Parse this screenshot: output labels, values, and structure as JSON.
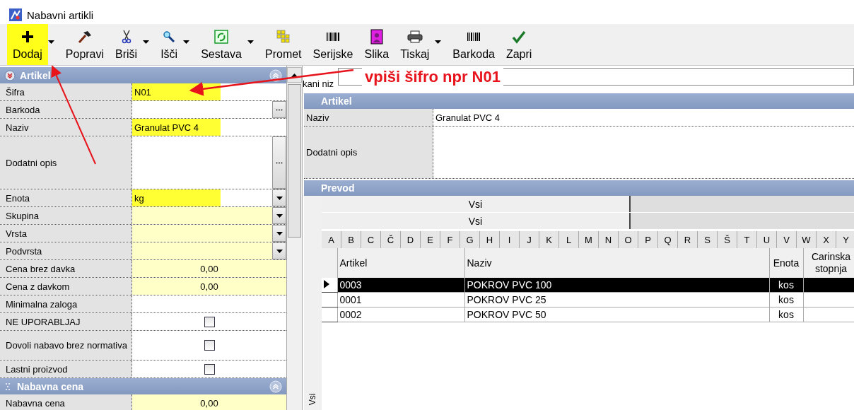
{
  "window": {
    "title": "Nabavni artikli"
  },
  "toolbar": [
    {
      "label": "Dodaj",
      "dropdown": true,
      "highlighted": true
    },
    {
      "label": "Popravi",
      "dropdown": false,
      "highlighted": false
    },
    {
      "label": "Briši",
      "dropdown": true,
      "highlighted": false
    },
    {
      "label": "Išči",
      "dropdown": true,
      "highlighted": false
    },
    {
      "label": "Sestava",
      "dropdown": true,
      "highlighted": false
    },
    {
      "label": "Promet",
      "dropdown": false,
      "highlighted": false
    },
    {
      "label": "Serijske",
      "dropdown": false,
      "highlighted": false
    },
    {
      "label": "Slika",
      "dropdown": false,
      "highlighted": false
    },
    {
      "label": "Tiskaj",
      "dropdown": true,
      "highlighted": false
    },
    {
      "label": "Barkoda",
      "dropdown": false,
      "highlighted": false
    },
    {
      "label": "Zapri",
      "dropdown": false,
      "highlighted": false
    }
  ],
  "properties": {
    "sections": [
      {
        "title": "Artikel",
        "rows": [
          {
            "label": "Šifra",
            "kind": "text",
            "value": "N01",
            "required": false,
            "highlighted": true
          },
          {
            "label": "Barkoda",
            "kind": "ellipsis",
            "required": false,
            "highlighted": false
          },
          {
            "label": "Naziv",
            "kind": "text",
            "value": "Granulat PVC 4",
            "required": false,
            "highlighted": true
          },
          {
            "label": "Dodatni opis",
            "kind": "memo",
            "required": false,
            "highlighted": false
          },
          {
            "label": "Enota",
            "kind": "dropdown",
            "value": "kg",
            "required": false,
            "highlighted": true
          },
          {
            "label": "Skupina",
            "kind": "dropdown",
            "required": true,
            "highlighted": false
          },
          {
            "label": "Vrsta",
            "kind": "dropdown",
            "required": true,
            "highlighted": false
          },
          {
            "label": "Podvrsta",
            "kind": "dropdown",
            "required": true,
            "highlighted": false
          },
          {
            "label": "Cena brez davka",
            "kind": "number",
            "value": "0,00",
            "required": true,
            "highlighted": false
          },
          {
            "label": "Cena z davkom",
            "kind": "number",
            "value": "0,00",
            "required": true,
            "highlighted": false
          },
          {
            "label": "Minimalna zaloga",
            "kind": "number",
            "required": false,
            "highlighted": false
          },
          {
            "label": "NE UPORABLJAJ",
            "kind": "checkbox",
            "checked": false,
            "required": false,
            "highlighted": false
          },
          {
            "label": "Dovoli nabavo brez normativa",
            "kind": "checkbox",
            "checked": false,
            "required": false,
            "highlighted": false
          },
          {
            "label": "Lastni proizvod",
            "kind": "checkbox",
            "checked": false,
            "required": false,
            "highlighted": false
          }
        ]
      },
      {
        "title": "Nabavna cena",
        "rows": [
          {
            "label": "Nabavna cena",
            "kind": "number",
            "value": "0,00",
            "required": true,
            "highlighted": false
          }
        ]
      }
    ]
  },
  "search": {
    "label": "kani niz"
  },
  "annotation": {
    "text": "vpiši šifro npr N01"
  },
  "detail": {
    "title": "Artikel",
    "rows": [
      {
        "label": "Naziv",
        "kind": "text",
        "value": "Granulat PVC 4"
      },
      {
        "label": "Dodatni opis",
        "kind": "memo"
      }
    ]
  },
  "translation": {
    "title": "Prevod",
    "filters": [
      "Vsi",
      "Vsi"
    ],
    "letters": [
      "A",
      "B",
      "C",
      "Č",
      "D",
      "E",
      "F",
      "G",
      "H",
      "I",
      "J",
      "K",
      "L",
      "M",
      "N",
      "O",
      "P",
      "Q",
      "R",
      "S",
      "Š",
      "T",
      "U",
      "V",
      "W",
      "X",
      "Y"
    ],
    "side_label": "Vsi",
    "table": {
      "columns": [
        "Artikel",
        "Naziv",
        "Enota",
        "Carinska stopnja"
      ],
      "rows": [
        {
          "cells": [
            "0003",
            "POKROV PVC 100",
            "kos"
          ],
          "selected": true
        },
        {
          "cells": [
            "0001",
            "POKROV PVC 25",
            "kos"
          ],
          "selected": false
        },
        {
          "cells": [
            "0002",
            "POKROV PVC 50",
            "kos"
          ],
          "selected": false
        }
      ]
    }
  }
}
